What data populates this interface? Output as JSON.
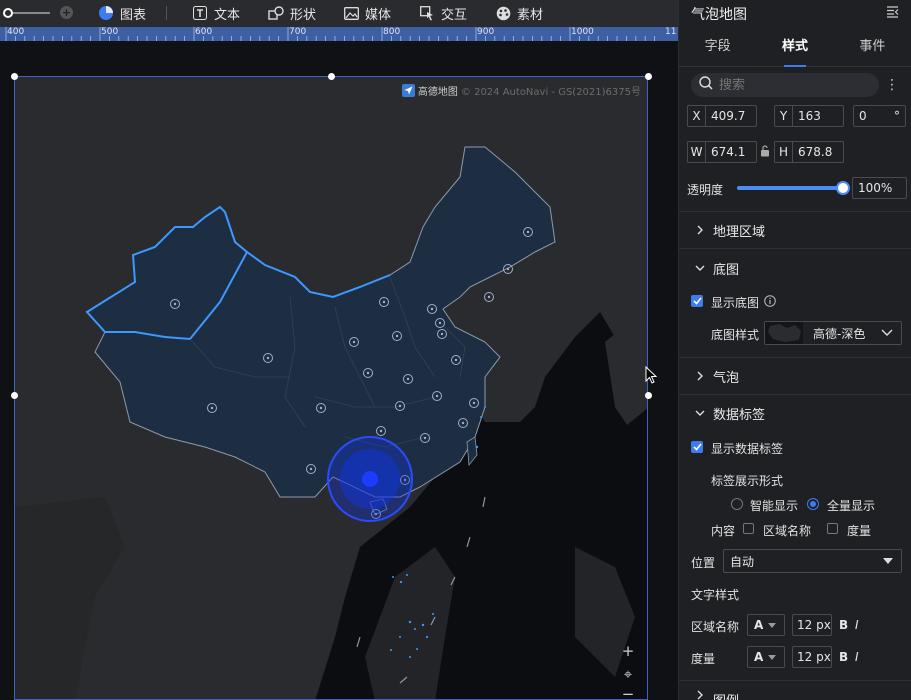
{
  "toolbar": {
    "items": [
      {
        "label": "图表",
        "icon": "chart-icon"
      },
      {
        "label": "文本",
        "icon": "text-icon"
      },
      {
        "label": "形状",
        "icon": "shape-icon"
      },
      {
        "label": "媒体",
        "icon": "media-icon"
      },
      {
        "label": "交互",
        "icon": "interact-icon"
      },
      {
        "label": "素材",
        "icon": "material-icon"
      }
    ]
  },
  "ruler": {
    "labels": [
      "400",
      "500",
      "600",
      "700",
      "800",
      "900",
      "1000",
      "11"
    ]
  },
  "map": {
    "credit_brand": "高德地图",
    "credit_text": "© 2024 AutoNavi - GS(2021)6375号",
    "zoom_in": "+",
    "locate": "⌖",
    "zoom_out": "−"
  },
  "panel": {
    "title": "气泡地图",
    "tabs": [
      "字段",
      "样式",
      "事件"
    ],
    "active_tab": "样式",
    "search_placeholder": "搜索",
    "position": {
      "x_label": "X",
      "x": "409.7",
      "y_label": "Y",
      "y": "163",
      "rotation": "0",
      "rotation_unit": "°"
    },
    "size": {
      "w_label": "W",
      "w": "674.1",
      "h_label": "H",
      "h": "678.8"
    },
    "opacity": {
      "label": "透明度",
      "value": "100%",
      "level": 1.0
    },
    "sections": {
      "geo_region": "地理区域",
      "base_map": "底图",
      "bubble": "气泡",
      "data_label": "数据标签",
      "legend": "图例"
    },
    "base_map": {
      "show_label": "显示底图",
      "show_checked": true,
      "style_label": "底图样式",
      "style_value": "高德-深色"
    },
    "data_label": {
      "show_label": "显示数据标签",
      "show_checked": true,
      "display_mode_label": "标签展示形式",
      "mode_smart": "智能显示",
      "mode_all": "全量显示",
      "selected_mode": "全量显示",
      "content_label": "内容",
      "content_region": "区域名称",
      "content_measure": "度量",
      "position_label": "位置",
      "position_value": "自动",
      "text_style_label": "文字样式",
      "region_name_label": "区域名称",
      "measure_label": "度量",
      "font_a": "A",
      "font_size_region": "12 px",
      "font_size_measure": "12 px",
      "bold": "B",
      "italic": "I"
    }
  },
  "colors": {
    "accent": "#3d7cf0",
    "border_blue": "#3d63c9",
    "bubble": "#1236e8"
  }
}
